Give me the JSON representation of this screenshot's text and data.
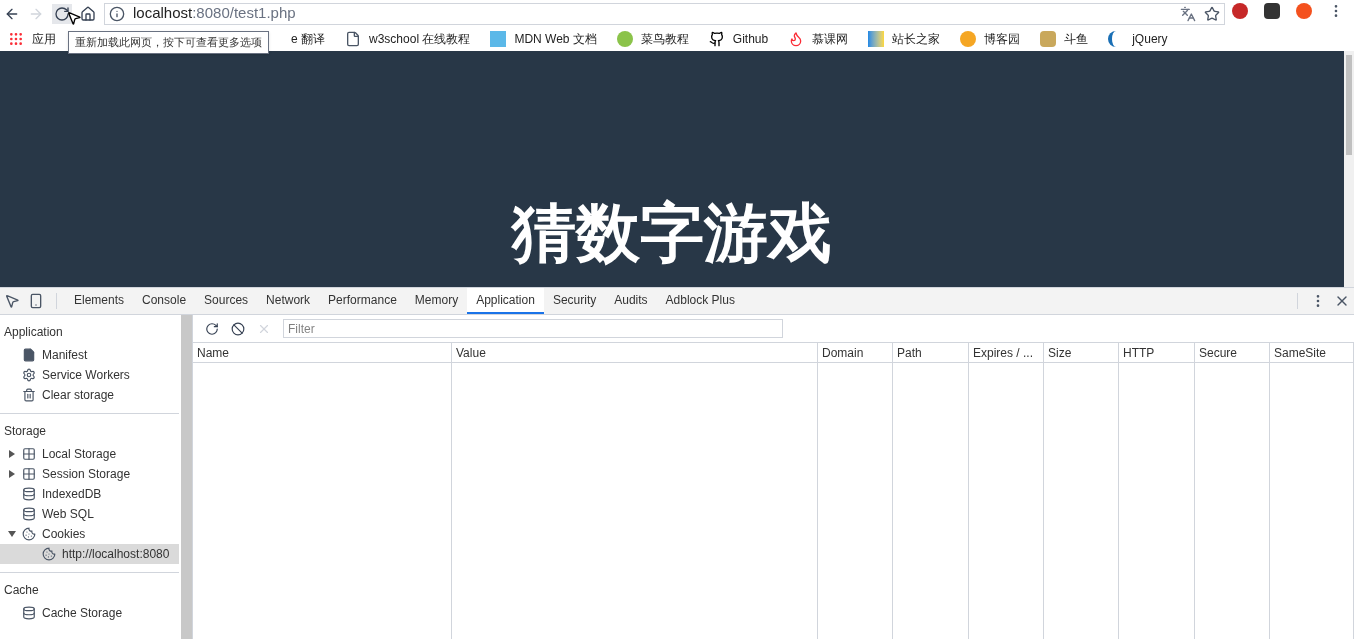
{
  "address_bar": {
    "host": "localhost",
    "rest": ":8080/test1.php"
  },
  "tooltip": "重新加载此网页，按下可查看更多选项",
  "bookmarks": [
    {
      "label": "应用",
      "kind": "apps"
    },
    {
      "label": "e 翻译",
      "kind": "none"
    },
    {
      "label": "w3school 在线教程",
      "kind": "page"
    },
    {
      "label": "MDN Web 文档",
      "kind": "mdn"
    },
    {
      "label": "菜鸟教程",
      "kind": "runoob"
    },
    {
      "label": "Github",
      "kind": "github"
    },
    {
      "label": "慕课网",
      "kind": "flame"
    },
    {
      "label": "站长之家",
      "kind": "chinaz"
    },
    {
      "label": "博客园",
      "kind": "cnblogs"
    },
    {
      "label": "斗鱼",
      "kind": "douyu"
    },
    {
      "label": "jQuery",
      "kind": "jquery"
    }
  ],
  "page": {
    "heading": "猜数字游戏"
  },
  "devtools": {
    "tabs": [
      {
        "label": "Elements",
        "selected": false
      },
      {
        "label": "Console",
        "selected": false
      },
      {
        "label": "Sources",
        "selected": false
      },
      {
        "label": "Network",
        "selected": false
      },
      {
        "label": "Performance",
        "selected": false
      },
      {
        "label": "Memory",
        "selected": false
      },
      {
        "label": "Application",
        "selected": true
      },
      {
        "label": "Security",
        "selected": false
      },
      {
        "label": "Audits",
        "selected": false
      },
      {
        "label": "Adblock Plus",
        "selected": false
      }
    ],
    "sidebar": [
      {
        "title": "Application",
        "items": [
          {
            "label": "Manifest",
            "kind": "file"
          },
          {
            "label": "Service Workers",
            "kind": "gear"
          },
          {
            "label": "Clear storage",
            "kind": "trash"
          }
        ]
      },
      {
        "title": "Storage",
        "items": [
          {
            "label": "Local Storage",
            "kind": "grid",
            "expanded": false
          },
          {
            "label": "Session Storage",
            "kind": "grid",
            "expanded": false
          },
          {
            "label": "IndexedDB",
            "kind": "db"
          },
          {
            "label": "Web SQL",
            "kind": "db"
          },
          {
            "label": "Cookies",
            "kind": "cookie",
            "expanded": true,
            "children": [
              {
                "label": "http://localhost:8080",
                "kind": "cookie",
                "selected": true
              }
            ]
          }
        ]
      },
      {
        "title": "Cache",
        "items": [
          {
            "label": "Cache Storage",
            "kind": "db"
          }
        ]
      }
    ],
    "filter": {
      "placeholder": "Filter"
    },
    "table": {
      "columns": [
        "Name",
        "Value",
        "Domain",
        "Path",
        "Expires / ...",
        "Size",
        "HTTP",
        "Secure",
        "SameSite"
      ]
    }
  }
}
